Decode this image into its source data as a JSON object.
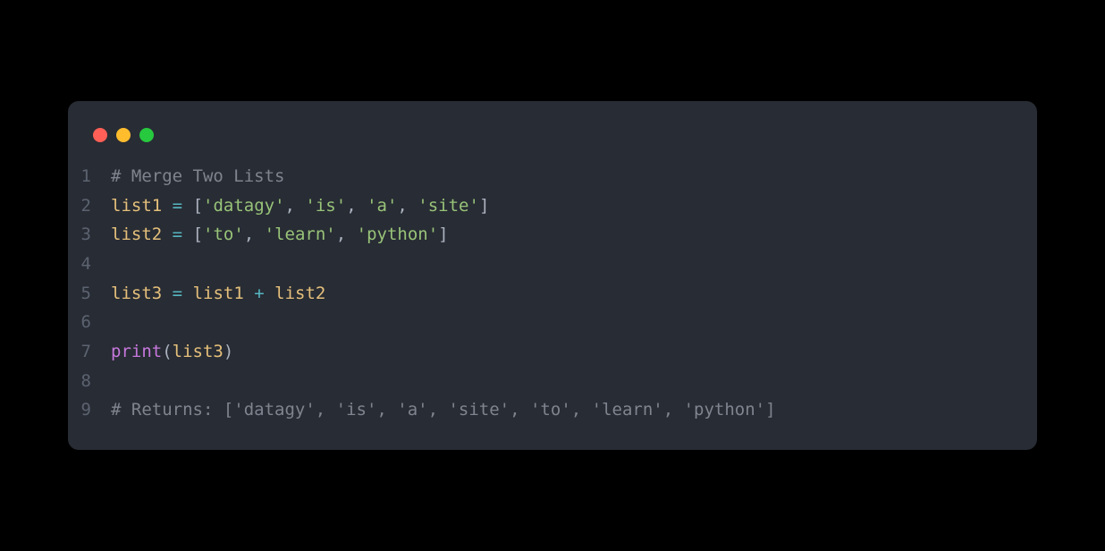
{
  "window": {
    "dots": [
      "red",
      "yellow",
      "green"
    ]
  },
  "code": {
    "lines": [
      {
        "num": "1",
        "tokens": [
          {
            "cls": "comment",
            "text": "# Merge Two Lists"
          }
        ]
      },
      {
        "num": "2",
        "tokens": [
          {
            "cls": "identifier",
            "text": "list1"
          },
          {
            "cls": "plain",
            "text": " "
          },
          {
            "cls": "operator",
            "text": "="
          },
          {
            "cls": "plain",
            "text": " "
          },
          {
            "cls": "bracket",
            "text": "["
          },
          {
            "cls": "string",
            "text": "'datagy'"
          },
          {
            "cls": "plain",
            "text": ", "
          },
          {
            "cls": "string",
            "text": "'is'"
          },
          {
            "cls": "plain",
            "text": ", "
          },
          {
            "cls": "string",
            "text": "'a'"
          },
          {
            "cls": "plain",
            "text": ", "
          },
          {
            "cls": "string",
            "text": "'site'"
          },
          {
            "cls": "bracket",
            "text": "]"
          }
        ]
      },
      {
        "num": "3",
        "tokens": [
          {
            "cls": "identifier",
            "text": "list2"
          },
          {
            "cls": "plain",
            "text": " "
          },
          {
            "cls": "operator",
            "text": "="
          },
          {
            "cls": "plain",
            "text": " "
          },
          {
            "cls": "bracket",
            "text": "["
          },
          {
            "cls": "string",
            "text": "'to'"
          },
          {
            "cls": "plain",
            "text": ", "
          },
          {
            "cls": "string",
            "text": "'learn'"
          },
          {
            "cls": "plain",
            "text": ", "
          },
          {
            "cls": "string",
            "text": "'python'"
          },
          {
            "cls": "bracket",
            "text": "]"
          }
        ]
      },
      {
        "num": "4",
        "tokens": []
      },
      {
        "num": "5",
        "tokens": [
          {
            "cls": "identifier",
            "text": "list3"
          },
          {
            "cls": "plain",
            "text": " "
          },
          {
            "cls": "operator",
            "text": "="
          },
          {
            "cls": "plain",
            "text": " "
          },
          {
            "cls": "identifier",
            "text": "list1"
          },
          {
            "cls": "plain",
            "text": " "
          },
          {
            "cls": "operator",
            "text": "+"
          },
          {
            "cls": "plain",
            "text": " "
          },
          {
            "cls": "identifier",
            "text": "list2"
          }
        ]
      },
      {
        "num": "6",
        "tokens": []
      },
      {
        "num": "7",
        "tokens": [
          {
            "cls": "func",
            "text": "print"
          },
          {
            "cls": "bracket",
            "text": "("
          },
          {
            "cls": "identifier",
            "text": "list3"
          },
          {
            "cls": "bracket",
            "text": ")"
          }
        ]
      },
      {
        "num": "8",
        "tokens": []
      },
      {
        "num": "9",
        "tokens": [
          {
            "cls": "comment",
            "text": "# Returns: ['datagy', 'is', 'a', 'site', 'to', 'learn', 'python']"
          }
        ]
      }
    ]
  }
}
